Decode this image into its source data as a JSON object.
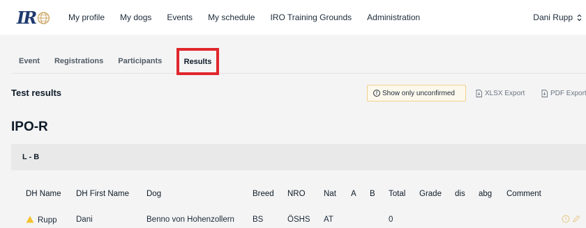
{
  "header": {
    "logo_text": "IR",
    "nav": [
      "My profile",
      "My dogs",
      "Events",
      "My schedule",
      "IRO Training Grounds",
      "Administration"
    ],
    "user": "Dani Rupp"
  },
  "tabs": {
    "event": "Event",
    "registrations": "Registrations",
    "participants": "Participants",
    "results": "Results"
  },
  "results": {
    "title": "Test results",
    "unconfirmed_label": "Show only unconfirmed",
    "xlsx_label": "XLSX Export",
    "pdf_label": "PDF Export"
  },
  "event_name": "IPO-R",
  "group": "L - B",
  "table": {
    "headers": [
      "DH Name",
      "DH First Name",
      "Dog",
      "Breed",
      "NRO",
      "Nat",
      "A",
      "B",
      "Total",
      "Grade",
      "dis",
      "abg",
      "Comment"
    ],
    "rows": [
      [
        "Rupp",
        "Dani",
        "Benno von Hohenzollern",
        "BS",
        "ÖSHS",
        "AT",
        "",
        "",
        "0",
        "",
        "",
        "",
        ""
      ]
    ]
  },
  "colors": {
    "highlight": "#e0272d",
    "warning": "#f2c230",
    "brand": "#1f3a6e"
  }
}
